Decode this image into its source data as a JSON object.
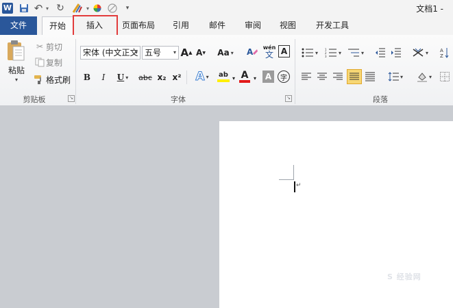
{
  "title_bar": {
    "doc_title": "文档1 -",
    "word_icon": "W",
    "undo_icon": "↶",
    "redo_icon": "↻",
    "brush_icon": "✎",
    "menu_glyph": "▾"
  },
  "tabs": [
    {
      "label": "文件"
    },
    {
      "label": "开始"
    },
    {
      "label": "插入"
    },
    {
      "label": "页面布局"
    },
    {
      "label": "引用"
    },
    {
      "label": "邮件"
    },
    {
      "label": "审阅"
    },
    {
      "label": "视图"
    },
    {
      "label": "开发工具"
    }
  ],
  "clipboard": {
    "paste": "粘贴",
    "cut": "剪切",
    "copy": "复制",
    "format_painter": "格式刷",
    "group_label": "剪贴板"
  },
  "font": {
    "font_name": "宋体 (中文正文",
    "font_size": "五号",
    "grow": "A",
    "shrink": "A",
    "change_case": "Aa",
    "clear_format": "A",
    "phonetic": "wén",
    "phonetic_sub": "文",
    "border_char": "A",
    "bold": "B",
    "italic": "I",
    "underline": "U",
    "strikethrough": "abc",
    "subscript": "x₂",
    "superscript": "x²",
    "text_effect": "A",
    "highlight": "ab",
    "font_color": "A",
    "char_shading": "A",
    "enclose": "字",
    "group_label": "字体"
  },
  "paragraph": {
    "group_label": "段落"
  },
  "watermark": "S 经验网",
  "colors": {
    "accent": "#2a579a",
    "highlight_box": "#e23b3b",
    "active_align": "#f7d774",
    "font_color_red": "#e21a1a",
    "highlight_yellow": "#ffef00"
  }
}
